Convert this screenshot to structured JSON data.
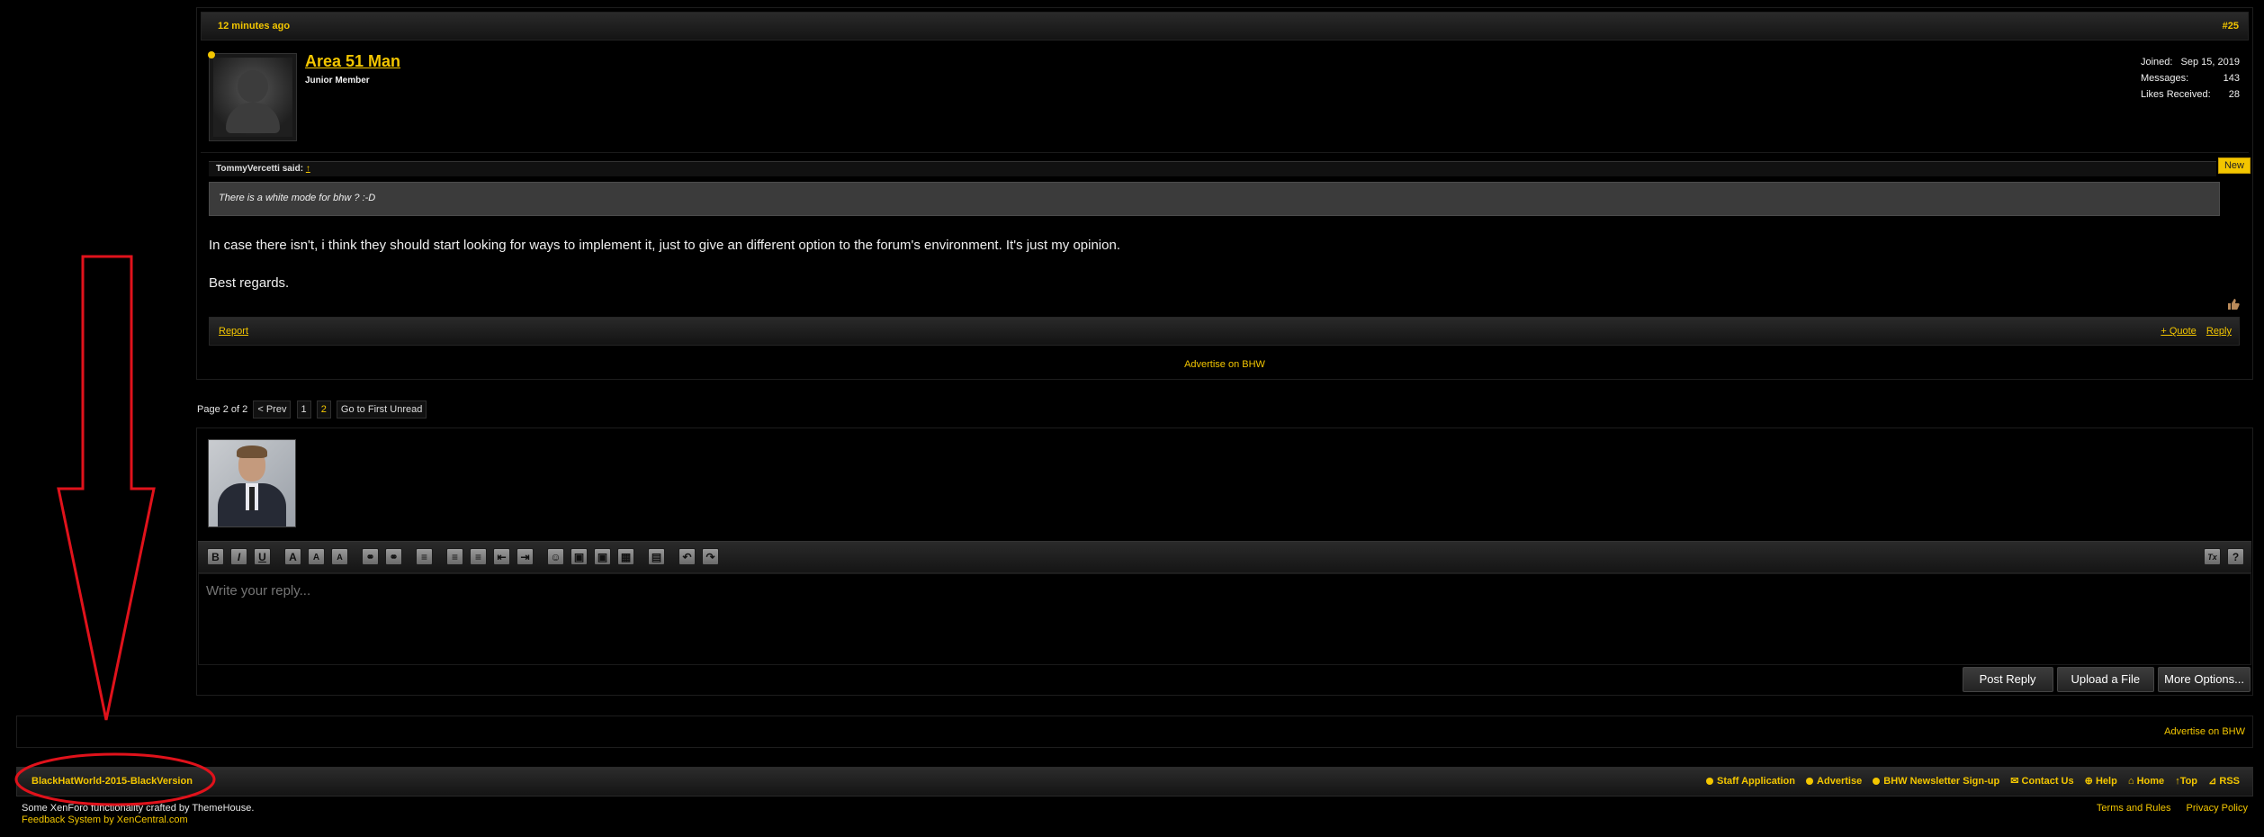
{
  "post": {
    "time": "12 minutes ago",
    "number": "#25",
    "username": "Area 51 Man",
    "user_title": "Junior Member",
    "stats": [
      {
        "label": "Joined:",
        "value": "Sep 15, 2019"
      },
      {
        "label": "Messages:",
        "value": "143"
      },
      {
        "label": "Likes Received:",
        "value": "28"
      }
    ],
    "new_badge": "New",
    "quote_author": "TommyVercetti said:",
    "quote_arrow": "↑",
    "quote_text": "There is a white mode for bhw ? :-D",
    "message_line1": "In case there isn't, i think they should start looking for ways to implement it, just to give an different option to the forum's environment. It's just my opinion.",
    "message_line2": "Best regards.",
    "report_label": "Report",
    "quote_label": "+ Quote",
    "reply_label": "Reply"
  },
  "advertise_mid": "Advertise on BHW",
  "pagination": {
    "summary": "Page 2 of 2",
    "prev": "< Prev",
    "pages": [
      "1",
      "2"
    ],
    "first_unread": "Go to First Unread"
  },
  "reply": {
    "placeholder": "Write your reply...",
    "toolbar": [
      "B",
      "I",
      "U",
      "A",
      "A",
      "A",
      "⚭",
      "⚭",
      "≡",
      "≡",
      "≡",
      "⇤",
      "⇥",
      "☺",
      "▣",
      "▣",
      "▦",
      "▤",
      "↶",
      "↷",
      "Tx",
      "?"
    ],
    "buttons": [
      "Post Reply",
      "Upload a File",
      "More Options..."
    ]
  },
  "advertise_bottom": "Advertise on BHW",
  "footer": {
    "style_name": "BlackHatWorld-2015-BlackVersion",
    "links": [
      "Staff Application",
      "Advertise",
      "BHW Newsletter Sign-up",
      "Contact Us",
      "Help",
      "Home",
      "Top",
      "RSS"
    ],
    "copyright1": "Some XenForo functionality crafted by ThemeHouse.",
    "copyright2": "Feedback System by XenCentral.com",
    "legal": [
      "Terms and Rules",
      "Privacy Policy"
    ]
  },
  "colors": {
    "accent": "#f3c600",
    "annotation": "#e0121b",
    "background": "#000000"
  }
}
